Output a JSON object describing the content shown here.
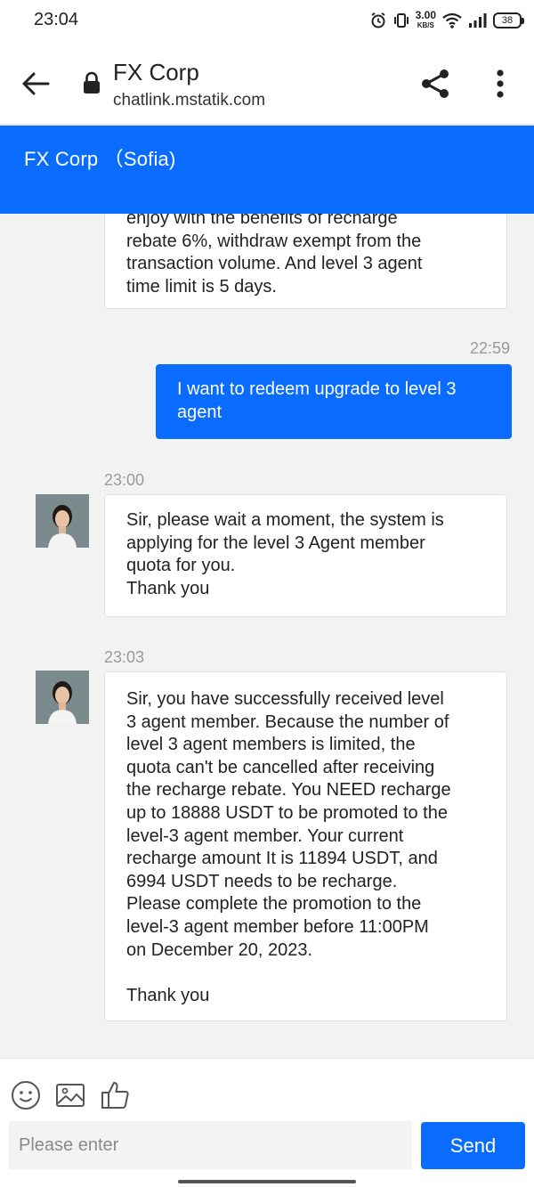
{
  "status_bar": {
    "time": "23:04",
    "net_speed_value": "3.00",
    "net_speed_unit": "KB/S",
    "battery": "38"
  },
  "browser": {
    "title": "FX Corp",
    "url": "chatlink.mstatik.com"
  },
  "chat_header": {
    "title": "FX Corp （Sofia)"
  },
  "messages": [
    {
      "direction": "incoming",
      "time": "",
      "text": "enjoy with the benefits of recharge\nrebate 6%, withdraw exempt from the\ntransaction volume. And level 3 agent\ntime limit is 5 days."
    },
    {
      "direction": "outgoing",
      "time": "22:59",
      "text": "I want to redeem upgrade to level 3\nagent"
    },
    {
      "direction": "incoming",
      "time": "23:00",
      "text": "Sir, please wait a moment, the system is\napplying for the level 3 Agent member\nquota for you.\nThank you"
    },
    {
      "direction": "incoming",
      "time": "23:03",
      "text": "Sir, you have successfully received level\n3 agent member. Because the number of\nlevel 3 agent members is limited, the\nquota can't be cancelled after receiving\nthe recharge rebate. You NEED recharge\nup to 18888 USDT to be promoted to the\nlevel-3 agent member. Your current\nrecharge amount It is 11894 USDT, and\n6994 USDT needs to be recharge.\nPlease complete the promotion to the\nlevel-3 agent member before 11:00PM\non December 20, 2023.\n\nThank you"
    }
  ],
  "input_bar": {
    "placeholder": "Please enter",
    "send_label": "Send",
    "icons": [
      "emoji-icon",
      "image-icon",
      "thumbs-up-icon"
    ]
  },
  "colors": {
    "accent": "#0a6cff",
    "background": "#f2f2f2",
    "bubble_in": "#ffffff",
    "timestamp": "#9a9a9a"
  }
}
